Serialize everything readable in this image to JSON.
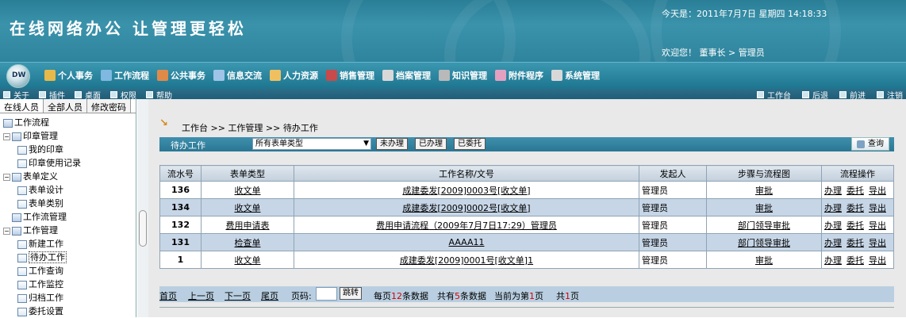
{
  "header": {
    "brand": "在线网络办公   让管理更轻松",
    "date": "今天是：2011年7月7日  星期四 14:18:33",
    "welcome": "欢迎您！ 董事长 > 管理员"
  },
  "main_menu": [
    {
      "label": "个人事务",
      "icon": "person-icon",
      "color": "#e6b94a"
    },
    {
      "label": "工作流程",
      "icon": "workflow-icon",
      "color": "#7fb8e0"
    },
    {
      "label": "公共事务",
      "icon": "public-icon",
      "color": "#e08a4a"
    },
    {
      "label": "信息交流",
      "icon": "message-icon",
      "color": "#9fc4e8"
    },
    {
      "label": "人力资源",
      "icon": "hr-icon",
      "color": "#f0c060"
    },
    {
      "label": "销售管理",
      "icon": "sales-icon",
      "color": "#c84a4a"
    },
    {
      "label": "档案管理",
      "icon": "archive-icon",
      "color": "#d8d8d8"
    },
    {
      "label": "知识管理",
      "icon": "knowledge-icon",
      "color": "#b9b9b9"
    },
    {
      "label": "附件程序",
      "icon": "attachment-icon",
      "color": "#e4a0c0"
    },
    {
      "label": "系统管理",
      "icon": "system-icon",
      "color": "#d8d8d8"
    }
  ],
  "toolbar": {
    "left": [
      "关于",
      "插件",
      "桌面",
      "权限",
      "帮助"
    ],
    "right": [
      "工作台",
      "后退",
      "前进",
      "注销"
    ]
  },
  "sidebar": {
    "tabs": [
      "在线人员",
      "全部人员",
      "修改密码"
    ],
    "tree": [
      {
        "label": "工作流程",
        "level": 0,
        "expander": ""
      },
      {
        "label": "印章管理",
        "level": 1,
        "expander": "−"
      },
      {
        "label": "我的印章",
        "level": 2,
        "expander": ""
      },
      {
        "label": "印章使用记录",
        "level": 2,
        "expander": ""
      },
      {
        "label": "表单定义",
        "level": 1,
        "expander": "−"
      },
      {
        "label": "表单设计",
        "level": 2,
        "expander": ""
      },
      {
        "label": "表单类别",
        "level": 2,
        "expander": ""
      },
      {
        "label": "工作流管理",
        "level": 1,
        "expander": ""
      },
      {
        "label": "工作管理",
        "level": 1,
        "expander": "−"
      },
      {
        "label": "新建工作",
        "level": 2,
        "expander": ""
      },
      {
        "label": "待办工作",
        "level": 2,
        "expander": "",
        "selected": true
      },
      {
        "label": "工作查询",
        "level": 2,
        "expander": ""
      },
      {
        "label": "工作监控",
        "level": 2,
        "expander": ""
      },
      {
        "label": "归档工作",
        "level": 2,
        "expander": ""
      },
      {
        "label": "委托设置",
        "level": 2,
        "expander": ""
      }
    ]
  },
  "breadcrumb": "工作台 >> 工作管理 >> 待办工作",
  "filter": {
    "label": "待办工作",
    "select_value": "所有表单类型",
    "buttons": [
      "未办理",
      "已办理",
      "已委托"
    ],
    "query": "查询"
  },
  "table": {
    "headers": [
      "流水号",
      "表单类型",
      "工作名称/文号",
      "发起人",
      "步骤与流程图",
      "流程操作"
    ],
    "rows": [
      {
        "id": "136",
        "form": "收文单",
        "name": "成建委发[2009]0003号[收文单]",
        "initiator": "管理员",
        "step": "审批",
        "ops": [
          "办理",
          "委托",
          "导出"
        ]
      },
      {
        "id": "134",
        "form": "收文单",
        "name": "成建委发[2009]0002号[收文单]",
        "initiator": "管理员",
        "step": "审批",
        "ops": [
          "办理",
          "委托",
          "导出"
        ]
      },
      {
        "id": "132",
        "form": "费用申请表",
        "name": "费用申请流程（2009年7月7日17:29）管理员",
        "initiator": "管理员",
        "step": "部门领导审批",
        "ops": [
          "办理",
          "委托",
          "导出"
        ]
      },
      {
        "id": "131",
        "form": "检查单",
        "name": "AAAA11",
        "initiator": "管理员",
        "step": "部门领导审批",
        "ops": [
          "办理",
          "委托",
          "导出"
        ]
      },
      {
        "id": "1",
        "form": "收文单",
        "name": "成建委发[2009]0001号[收文单]1",
        "initiator": "管理员",
        "step": "审批",
        "ops": [
          "办理",
          "委托",
          "导出"
        ]
      }
    ]
  },
  "pager": {
    "first": "首页",
    "prev": "上一页",
    "next": "下一页",
    "last": "尾页",
    "page_label": "页码:",
    "jump": "跳转",
    "per_page_pre": "每页",
    "per_page": "12",
    "per_page_post": "条数据",
    "total_pre": "共有",
    "total": "5",
    "total_post": "条数据",
    "current_pre": "当前为第",
    "current": "1",
    "current_post": "页",
    "pages_pre": "共",
    "pages": "1",
    "pages_post": "页"
  }
}
